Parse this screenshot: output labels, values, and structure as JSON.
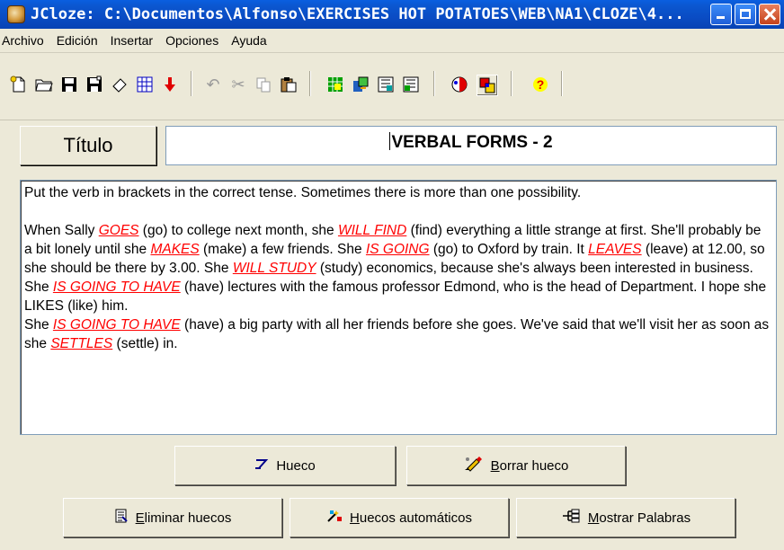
{
  "window": {
    "title": "JCloze: C:\\Documentos\\Alfonso\\EXERCISES HOT POTATOES\\WEB\\NA1\\CLOZE\\4..."
  },
  "menu": [
    "Archivo",
    "Edición",
    "Insertar",
    "Opciones",
    "Ayuda"
  ],
  "toolbar": {
    "icons": [
      "new-file-icon",
      "open-folder-icon",
      "save-icon",
      "save-as-icon",
      "eraser-icon",
      "web-icon",
      "arrow-down-icon",
      "undo-icon",
      "cut-icon",
      "copy-icon",
      "paste-icon",
      "config-icon",
      "export-icon",
      "settings-icon",
      "settings-alt-icon",
      "view-icon",
      "split-icon",
      "help-icon"
    ]
  },
  "title_label": "Título",
  "title_value": "VERBAL FORMS - 2",
  "exercise": {
    "instruction": "Put the verb in brackets in the correct tense. Sometimes there is more than one possibility.",
    "p1": {
      "t1": "When Sally ",
      "g1": "GOES",
      "t2": " (go) to college next month, she ",
      "g2": "WILL FIND",
      "t3": " (find) everything a little strange at first. She'll probably be a bit lonely until she ",
      "g3": "MAKES",
      "t4": " (make) a few friends. She ",
      "g4": "IS GOING",
      "t5": " (go) to Oxford by train. It ",
      "g5": "LEAVES",
      "t6": " (leave) at 12.00, so she should be there by 3.00. She ",
      "g6": "WILL STUDY",
      "t7": " (study) economics, because she's always been interested in business. She ",
      "g7": "IS GOING TO HAVE",
      "t8": " (have) lectures with the famous professor Edmond, who is the head of Department. I hope she LIKES (like) him."
    },
    "p2": {
      "t1": "She ",
      "g1": "IS GOING TO HAVE",
      "t2": " (have) a big party with all her friends before she goes. We've said that we'll visit her as soon as she ",
      "g2": "SETTLES",
      "t3": " (settle) in."
    }
  },
  "buttons": {
    "gap": "Hueco",
    "delete_gap_ul": "B",
    "delete_gap_rest": "orrar hueco",
    "remove_gaps_ul": "E",
    "remove_gaps_rest": "liminar huecos",
    "auto_gaps_ul": "H",
    "auto_gaps_rest": "uecos automáticos",
    "show_words_ul": "M",
    "show_words_rest": "ostrar Palabras"
  },
  "colors": {
    "gap_text": "#ff0000",
    "titlebar": "#0a4cc4",
    "window_bg": "#ece9d8"
  }
}
